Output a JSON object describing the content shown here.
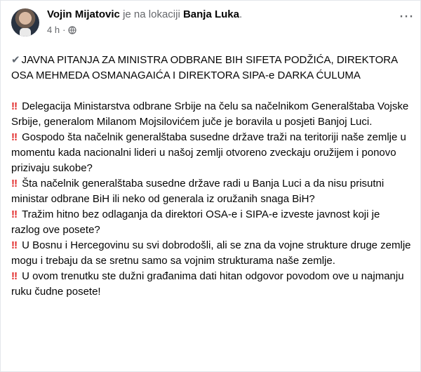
{
  "post": {
    "author": "Vojin Mijatovic",
    "location_prefix": "je na lokaciji",
    "location": "Banja Luka",
    "location_suffix": ".",
    "time": "4 h",
    "separator": "·",
    "more_icon": "more-options-icon",
    "title_icon": "✔",
    "title": "JAVNA PITANJA ZA MINISTRA ODBRANE BIH SIFETA PODŽIĆA, DIREKTORA OSA MEHMEDA OSMANAGAIĆA I DIREKTORA SIPA-e DARKA ĆULUMA",
    "paragraphs": [
      {
        "icon": "‼",
        "text": "Delegacija Ministarstva odbrane Srbije na čelu sa načelnikom Generalštaba Vojske Srbije, generalom Milanom Mojsilovićem juče je boravila u posjeti Banjoj Luci."
      },
      {
        "icon": "‼",
        "text": "Gospodo šta načelnik generalštaba susedne države traži na teritoriji naše zemlje u momentu kada nacionalni lideri u našoj zemlji otvoreno zveckaju oružijem i ponovo prizivaju sukobe?"
      },
      {
        "icon": "‼",
        "text": "Šta načelnik generalštaba susedne države radi u Banja Luci a da nisu prisutni ministar odbrane BiH ili neko od generala iz oružanih snaga BiH?"
      },
      {
        "icon": "‼",
        "text": "Tražim hitno bez odlaganja da direktori OSA-e i SIPA-e izveste javnost koji je razlog ove posete?"
      },
      {
        "icon": "‼",
        "text": "U Bosnu i Hercegovinu su svi dobrodošli, ali se zna da vojne strukture druge zemlje mogu i trebaju da se sretnu samo sa vojnim strukturama naše zemlje."
      },
      {
        "icon": "‼",
        "text": "U ovom trenutku ste dužni građanima dati hitan odgovor povodom ove u najmanju ruku čudne posete!"
      }
    ]
  }
}
